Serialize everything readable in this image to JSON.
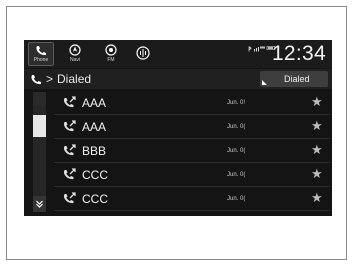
{
  "topbar": {
    "buttons": [
      {
        "label": "Phone",
        "icon": "phone-icon"
      },
      {
        "label": "Navi",
        "icon": "navi-icon"
      },
      {
        "label": "FM",
        "icon": "fm-icon"
      },
      {
        "label": "",
        "icon": "audio-source-icon"
      }
    ],
    "status_icons": [
      "bluetooth-icon",
      "signal-bars-icon",
      "battery-icon"
    ],
    "clock": "12:34"
  },
  "header": {
    "breadcrumb_separator": ">",
    "breadcrumb_label": "Dialed",
    "sort_button_label": "Dialed"
  },
  "calls": [
    {
      "name": "AAA",
      "date": "Jun. 0!",
      "icon": "outgoing-call-icon",
      "favorite_icon": "star-icon"
    },
    {
      "name": "AAA",
      "date": "Jun. 0(",
      "icon": "outgoing-call-icon",
      "favorite_icon": "star-icon"
    },
    {
      "name": "BBB",
      "date": "Jun. 0(",
      "icon": "outgoing-call-icon",
      "favorite_icon": "star-icon"
    },
    {
      "name": "CCC",
      "date": "Jun. 0(",
      "icon": "outgoing-call-icon",
      "favorite_icon": "star-icon"
    },
    {
      "name": "CCC",
      "date": "Jun. 0(",
      "icon": "outgoing-call-icon",
      "favorite_icon": "star-icon"
    }
  ],
  "colors": {
    "screen_bg": "#141414",
    "text": "#f2f2f2",
    "star": "#bdbdbd"
  }
}
